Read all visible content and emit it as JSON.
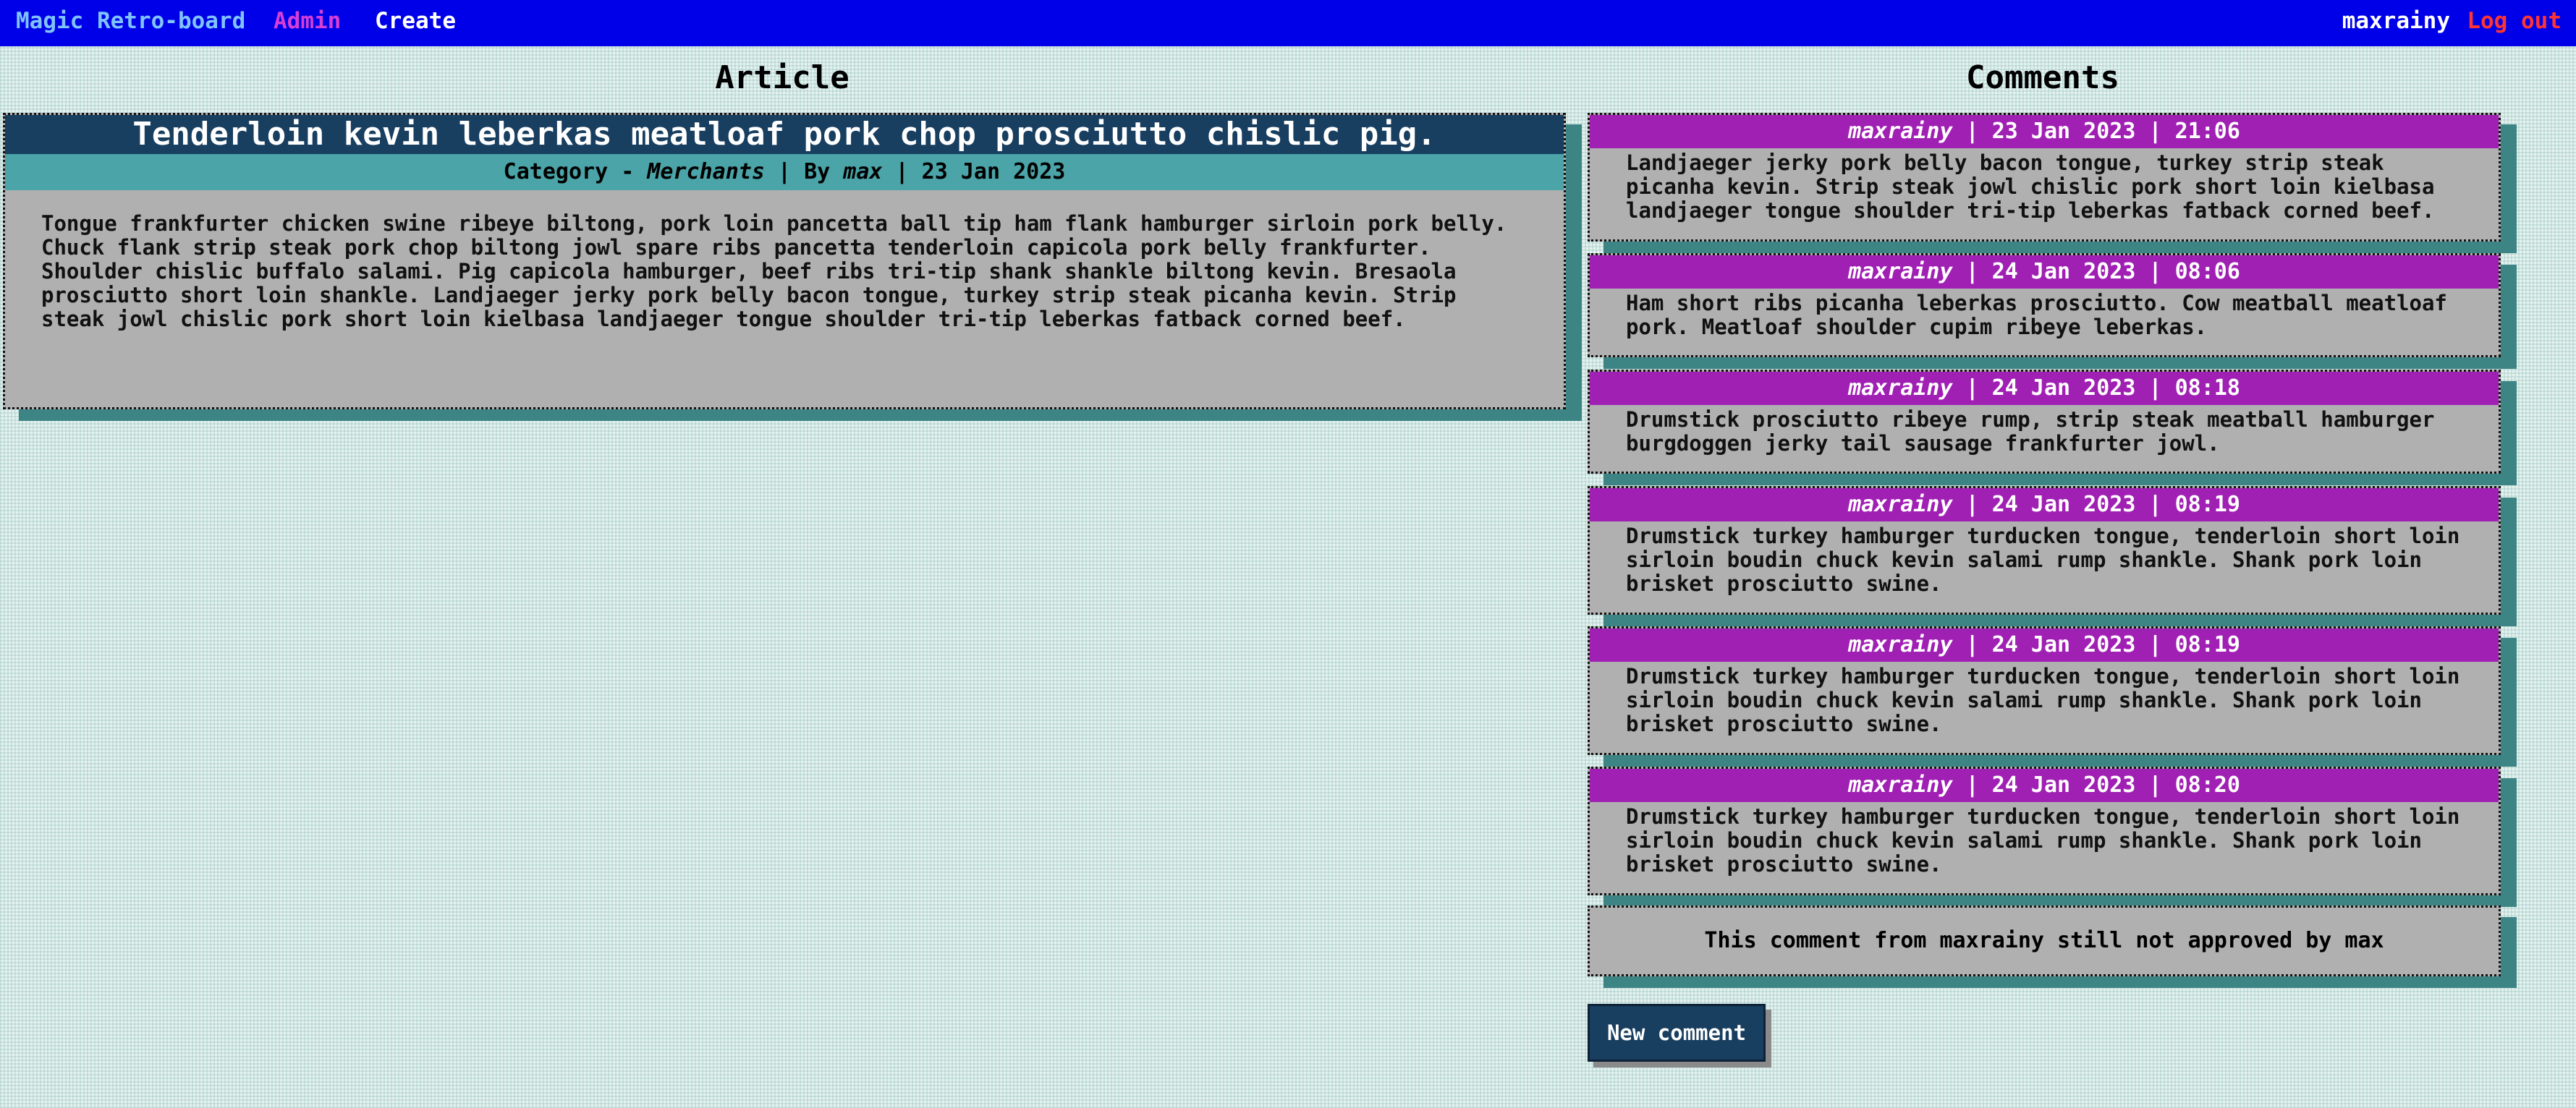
{
  "nav": {
    "brand": "Magic Retro-board",
    "admin": "Admin",
    "create": "Create",
    "username": "maxrainy",
    "logout": "Log out"
  },
  "headings": {
    "article": "Article",
    "comments": "Comments"
  },
  "article": {
    "title": "Tenderloin kevin leberkas meatloaf pork chop prosciutto chislic pig.",
    "category_prefix": "Category - ",
    "category": "Merchants",
    "by_prefix": " | By ",
    "author": "max",
    "date_sep": " | ",
    "date": "23 Jan 2023",
    "body": "Tongue frankfurter chicken swine ribeye biltong, pork loin pancetta ball tip ham flank hamburger sirloin pork belly. Chuck flank strip steak pork chop biltong jowl spare ribs pancetta tenderloin capicola pork belly frankfurter. Shoulder chislic buffalo salami. Pig capicola hamburger, beef ribs tri-tip shank shankle biltong kevin. Bresaola prosciutto short loin shankle. Landjaeger jerky pork belly bacon tongue, turkey strip steak picanha kevin. Strip steak jowl chislic pork short loin kielbasa landjaeger tongue shoulder tri-tip leberkas fatback corned beef."
  },
  "comments": [
    {
      "author": "maxrainy",
      "meta": " | 23 Jan 2023 | 21:06",
      "body": "Landjaeger jerky pork belly bacon tongue, turkey strip steak picanha kevin. Strip steak jowl chislic pork short loin kielbasa landjaeger tongue shoulder tri-tip leberkas fatback corned beef."
    },
    {
      "author": "maxrainy",
      "meta": " | 24 Jan 2023 | 08:06",
      "body": "Ham short ribs picanha leberkas prosciutto. Cow meatball meatloaf pork. Meatloaf shoulder cupim ribeye leberkas."
    },
    {
      "author": "maxrainy",
      "meta": " | 24 Jan 2023 | 08:18",
      "body": "Drumstick prosciutto ribeye rump, strip steak meatball hamburger burgdoggen jerky tail sausage frankfurter jowl."
    },
    {
      "author": "maxrainy",
      "meta": " | 24 Jan 2023 | 08:19",
      "body": "Drumstick turkey hamburger turducken tongue, tenderloin short loin sirloin boudin chuck kevin salami rump shankle. Shank pork loin brisket prosciutto swine."
    },
    {
      "author": "maxrainy",
      "meta": " | 24 Jan 2023 | 08:19",
      "body": "Drumstick turkey hamburger turducken tongue, tenderloin short loin sirloin boudin chuck kevin salami rump shankle. Shank pork loin brisket prosciutto swine."
    },
    {
      "author": "maxrainy",
      "meta": " | 24 Jan 2023 | 08:20",
      "body": "Drumstick turkey hamburger turducken tongue, tenderloin short loin sirloin boudin chuck kevin salami rump shankle. Shank pork loin brisket prosciutto swine."
    }
  ],
  "pending_notice": "This comment from maxrainy still not approved by max",
  "new_comment_label": "New comment",
  "colors": {
    "topbar": "#0000e8",
    "article_title_bg": "#183e60",
    "article_meta_bg": "#4aa4a8",
    "comment_header_bg": "#a020b4",
    "card_bg": "#b0b0b0",
    "card_shadow": "#3d8585",
    "logout": "#ff3434",
    "admin": "#d63fd6",
    "brand": "#7fc3ff"
  }
}
